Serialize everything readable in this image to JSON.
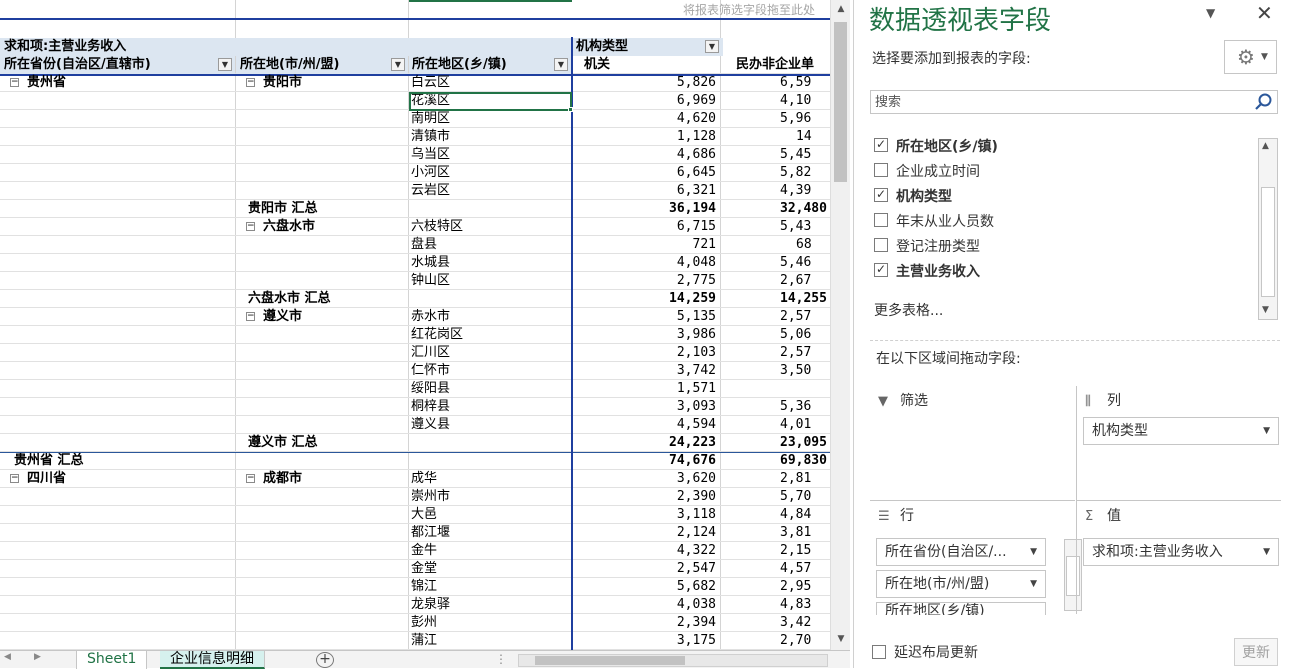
{
  "sheet": {
    "filter_hint": "将报表筛选字段拖至此处",
    "value_header": "求和项:主营业务收入",
    "col_field_header": "机构类型",
    "row_headers": [
      "所在省份(自治区/直辖市)",
      "所在地(市/州/盟)",
      "所在地区(乡/镇)"
    ],
    "col_labels": [
      "机关",
      "民办非企业单"
    ],
    "rows": [
      {
        "c1": "贵州省",
        "c1_collapse": true,
        "c2": "贵阳市",
        "c2_collapse": true,
        "c3": "白云区",
        "v1": "5,826",
        "v2": "6,59"
      },
      {
        "c1": "",
        "c2": "",
        "c3": "花溪区",
        "v1": "6,969",
        "v2": "4,10"
      },
      {
        "c1": "",
        "c2": "",
        "c3": "南明区",
        "v1": "4,620",
        "v2": "5,96"
      },
      {
        "c1": "",
        "c2": "",
        "c3": "清镇市",
        "v1": "1,128",
        "v2": "14"
      },
      {
        "c1": "",
        "c2": "",
        "c3": "乌当区",
        "v1": "4,686",
        "v2": "5,45"
      },
      {
        "c1": "",
        "c2": "",
        "c3": "小河区",
        "v1": "6,645",
        "v2": "5,82"
      },
      {
        "c1": "",
        "c2": "",
        "c3": "云岩区",
        "v1": "6,321",
        "v2": "4,39"
      },
      {
        "c1": "",
        "c2": "贵阳市 汇总",
        "subtotal": true,
        "c3": "",
        "v1": "36,194",
        "v2": "32,480"
      },
      {
        "c1": "",
        "c2": "六盘水市",
        "c2_collapse": true,
        "c3": "六枝特区",
        "v1": "6,715",
        "v2": "5,43"
      },
      {
        "c1": "",
        "c2": "",
        "c3": "盘县",
        "v1": "721",
        "v2": "68"
      },
      {
        "c1": "",
        "c2": "",
        "c3": "水城县",
        "v1": "4,048",
        "v2": "5,46"
      },
      {
        "c1": "",
        "c2": "",
        "c3": "钟山区",
        "v1": "2,775",
        "v2": "2,67"
      },
      {
        "c1": "",
        "c2": "六盘水市 汇总",
        "subtotal": true,
        "c3": "",
        "v1": "14,259",
        "v2": "14,255"
      },
      {
        "c1": "",
        "c2": "遵义市",
        "c2_collapse": true,
        "c3": "赤水市",
        "v1": "5,135",
        "v2": "2,57"
      },
      {
        "c1": "",
        "c2": "",
        "c3": "红花岗区",
        "v1": "3,986",
        "v2": "5,06"
      },
      {
        "c1": "",
        "c2": "",
        "c3": "汇川区",
        "v1": "2,103",
        "v2": "2,57"
      },
      {
        "c1": "",
        "c2": "",
        "c3": "仁怀市",
        "v1": "3,742",
        "v2": "3,50"
      },
      {
        "c1": "",
        "c2": "",
        "c3": "绥阳县",
        "v1": "1,571",
        "v2": ""
      },
      {
        "c1": "",
        "c2": "",
        "c3": "桐梓县",
        "v1": "3,093",
        "v2": "5,36"
      },
      {
        "c1": "",
        "c2": "",
        "c3": "遵义县",
        "v1": "4,594",
        "v2": "4,01"
      },
      {
        "c1": "",
        "c2": "遵义市 汇总",
        "subtotal": true,
        "c3": "",
        "v1": "24,223",
        "v2": "23,095"
      },
      {
        "c1": "贵州省 汇总",
        "c1_subtotal": true,
        "c2": "",
        "c3": "",
        "v1": "74,676",
        "v2": "69,830"
      },
      {
        "c1": "四川省",
        "c1_collapse": true,
        "c2": "成都市",
        "c2_collapse": true,
        "c3": "成华",
        "v1": "3,620",
        "v2": "2,81"
      },
      {
        "c1": "",
        "c2": "",
        "c3": "崇州市",
        "v1": "2,390",
        "v2": "5,70"
      },
      {
        "c1": "",
        "c2": "",
        "c3": "大邑",
        "v1": "3,118",
        "v2": "4,84"
      },
      {
        "c1": "",
        "c2": "",
        "c3": "都江堰",
        "v1": "2,124",
        "v2": "3,81"
      },
      {
        "c1": "",
        "c2": "",
        "c3": "金牛",
        "v1": "4,322",
        "v2": "2,15"
      },
      {
        "c1": "",
        "c2": "",
        "c3": "金堂",
        "v1": "2,547",
        "v2": "4,57"
      },
      {
        "c1": "",
        "c2": "",
        "c3": "锦江",
        "v1": "5,682",
        "v2": "2,95"
      },
      {
        "c1": "",
        "c2": "",
        "c3": "龙泉驿",
        "v1": "4,038",
        "v2": "4,83"
      },
      {
        "c1": "",
        "c2": "",
        "c3": "彭州",
        "v1": "2,394",
        "v2": "3,42"
      },
      {
        "c1": "",
        "c2": "",
        "c3": "蒲江",
        "v1": "3,175",
        "v2": "2,70"
      }
    ]
  },
  "tabs": {
    "sheets": [
      "Sheet1",
      "企业信息明细"
    ],
    "active": "企业信息明细"
  },
  "panel": {
    "title": "数据透视表字段",
    "choose_label": "选择要添加到报表的字段:",
    "search_placeholder": "搜索",
    "fields": [
      {
        "label": "所在地区(乡/镇)",
        "checked": true
      },
      {
        "label": "企业成立时间",
        "checked": false
      },
      {
        "label": "机构类型",
        "checked": true
      },
      {
        "label": "年末从业人员数",
        "checked": false
      },
      {
        "label": "登记注册类型",
        "checked": false
      },
      {
        "label": "主营业务收入",
        "checked": true
      }
    ],
    "more_tables": "更多表格...",
    "drag_label": "在以下区域间拖动字段:",
    "areas": {
      "filter": {
        "title": "筛选",
        "icon": "filter-icon"
      },
      "columns": {
        "title": "列",
        "icon": "columns-icon",
        "items": [
          "机构类型"
        ]
      },
      "rows": {
        "title": "行",
        "icon": "rows-icon",
        "items": [
          "所在省份(自治区/...",
          "所在地(市/州/盟)",
          "所在地区(乡/镇)"
        ]
      },
      "values": {
        "title": "值",
        "icon": "sigma-icon",
        "items": [
          "求和项:主营业务收入"
        ]
      }
    },
    "defer_label": "延迟布局更新",
    "update_label": "更新"
  },
  "colors": {
    "accent_green": "#217346",
    "pivot_blue": "#1f3f9f",
    "header_fill": "#dce6f1",
    "tab_active_fill": "#d6f1ee"
  }
}
